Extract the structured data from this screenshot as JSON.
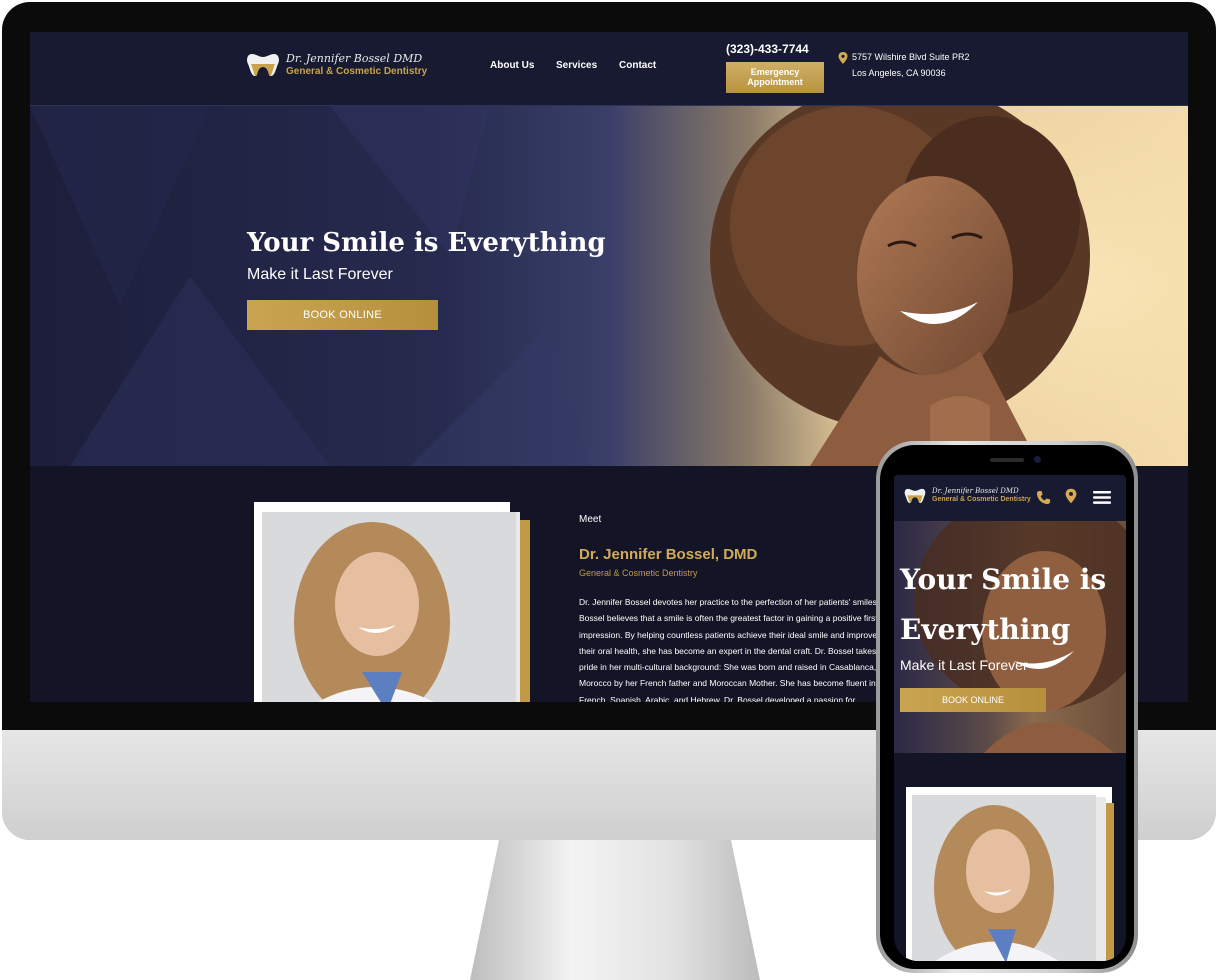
{
  "site": {
    "logo": {
      "signature": "Dr. Jennifer Bossel DMD",
      "subtitle": "General & Cosmetic Dentistry"
    },
    "nav": [
      {
        "label": "About Us"
      },
      {
        "label": "Services"
      },
      {
        "label": "Contact"
      }
    ],
    "phone": "(323)-433-7744",
    "emergency_button": {
      "line1": "Emergency",
      "line2": "Appointment"
    },
    "address": {
      "line1": "5757 Wilshire Blvd Suite PR2",
      "line2": "Los Angeles, CA 90036"
    }
  },
  "hero": {
    "title": "Your Smile is Everything",
    "subtitle": "Make it Last Forever",
    "book_button": "BOOK ONLINE"
  },
  "meet": {
    "label": "Meet",
    "name": "Dr. Jennifer Bossel, DMD",
    "specialty": "General & Cosmetic Dentistry",
    "bio_lines": [
      "Dr. Jennifer Bossel devotes her practice to the perfection of her patients' smiles. Dr.",
      "Bossel believes that a smile is often the greatest factor in gaining a positive first",
      "impression. By helping countless patients achieve their ideal smile and improve",
      "their oral health, she has become an expert in the dental craft. Dr. Bossel takes",
      "pride in her multi-cultural background: She was born and raised in Casablanca,",
      "Morocco by her French father and Moroccan Mother. She has become fluent in",
      "French, Spanish, Arabic, and Hebrew. Dr. Bossel developed a passion for"
    ]
  },
  "mobile": {
    "logo": {
      "signature": "Dr. Jennifer Bossel DMD",
      "subtitle": "General & Cosmetic Dentistry"
    },
    "icons": [
      "phone-icon",
      "map-pin-icon",
      "hamburger-menu-icon"
    ],
    "hero_title": "Your Smile is Everything",
    "hero_subtitle": "Make it Last Forever",
    "book_button": "BOOK ONLINE"
  },
  "colors": {
    "navy": "#171a31",
    "gold": "#c29a47",
    "dark_section": "#131526"
  }
}
